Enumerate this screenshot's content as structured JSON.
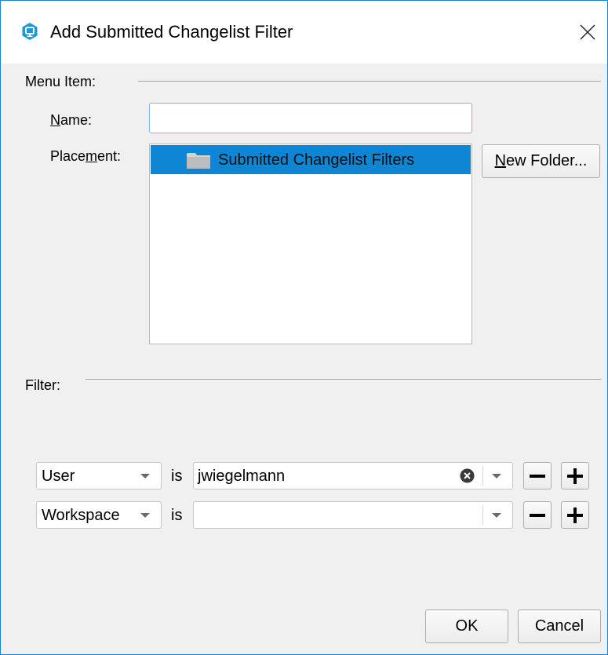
{
  "window": {
    "title": "Add Submitted Changelist Filter",
    "app_icon": "perforce-app-icon",
    "accent_color": "#1883d7"
  },
  "menu_item": {
    "section_label": "Menu Item:",
    "name_label_mnemonic": "N",
    "name_label_rest": "ame:",
    "name_value": "",
    "placement_label_before": "Place",
    "placement_label_mnemonic": "m",
    "placement_label_after": "ent:",
    "placement_items": [
      {
        "label": "Submitted Changelist Filters",
        "icon": "folder-icon",
        "selected": true
      }
    ],
    "selection_color": "#0e86d4",
    "new_folder_mnemonic": "N",
    "new_folder_rest": "ew Folder..."
  },
  "filter": {
    "section_label": "Filter:",
    "rows": [
      {
        "field": "User",
        "operator": "is",
        "value": "jwiegelmann",
        "has_clear": true
      },
      {
        "field": "Workspace",
        "operator": "is",
        "value": "",
        "has_clear": false
      }
    ]
  },
  "buttons": {
    "ok": "OK",
    "cancel": "Cancel"
  }
}
